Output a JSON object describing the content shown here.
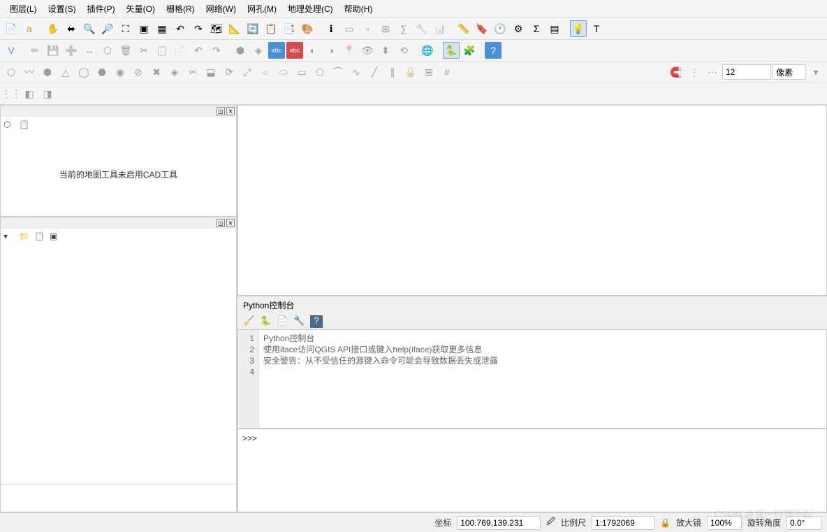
{
  "menu": {
    "layer": "图层(L)",
    "settings": "设置(S)",
    "plugins": "插件(P)",
    "vector": "矢量(O)",
    "raster": "栅格(R)",
    "network": "网络(W)",
    "mesh": "网孔(M)",
    "processing": "地理处理(C)",
    "help": "帮助(H)"
  },
  "toolbar3": {
    "spin_value": "12",
    "unit": "像素"
  },
  "left": {
    "cad_message": "当前的地图工具未启用CAD工具"
  },
  "python": {
    "title": "Python控制台",
    "prompt": ">>>",
    "lines": [
      "Python控制台",
      "使用iface访问QGIS API接口或键入help(iface)获取更多信息",
      "安全警告：从不受信任的源键入命令可能会导致数据丢失或泄露",
      ""
    ],
    "line_numbers": [
      "1",
      "2",
      "3",
      "4"
    ]
  },
  "status": {
    "coord_label": "坐标",
    "coord_value": "100.769,139.231",
    "scale_label": "比例尺",
    "scale_value": "1:1792069",
    "magnifier_label": "放大镜",
    "magnifier_value": "100%",
    "rotation_label": "旋转角度",
    "rotation_value": "0.0°"
  },
  "watermark": "CSDN @我一时想不起"
}
